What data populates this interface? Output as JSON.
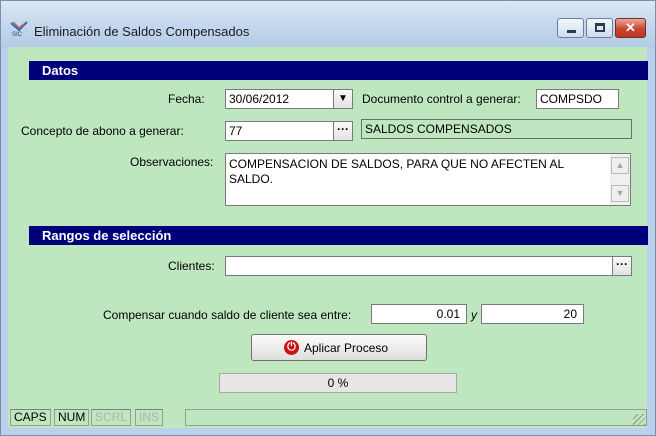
{
  "window": {
    "title": "Eliminación de Saldos Compensados",
    "icon": "sic-app-icon",
    "controls": {
      "minimize": "minimize-icon",
      "maximize": "maximize-icon",
      "close": "close-icon"
    }
  },
  "datos": {
    "header": "Datos",
    "fecha": {
      "label": "Fecha:",
      "value": "30/06/2012"
    },
    "documento": {
      "label": "Documento control a generar:",
      "value": "COMPSDO"
    },
    "concepto": {
      "label": "Concepto de abono a generar:",
      "value": "77",
      "description": "SALDOS COMPENSADOS"
    },
    "observaciones": {
      "label": "Observaciones:",
      "value": "COMPENSACION DE SALDOS, PARA QUE NO AFECTEN AL SALDO."
    }
  },
  "rangos": {
    "header": "Rangos de selección",
    "clientes": {
      "label": "Clientes:",
      "value": ""
    },
    "compensar": {
      "label": "Compensar cuando saldo de cliente sea entre:",
      "min": "0.01",
      "conj": "y",
      "max": "20"
    }
  },
  "actions": {
    "apply_label": "Aplicar Proceso"
  },
  "progress": {
    "text": "0 %",
    "value": 0
  },
  "statusbar": {
    "caps": "CAPS",
    "num": "NUM",
    "scrl": "SCRL",
    "ins": "INS"
  },
  "colors": {
    "header_bg": "#00007b",
    "client_bg": "#bfe7bf",
    "apply_icon": "#c81414"
  }
}
